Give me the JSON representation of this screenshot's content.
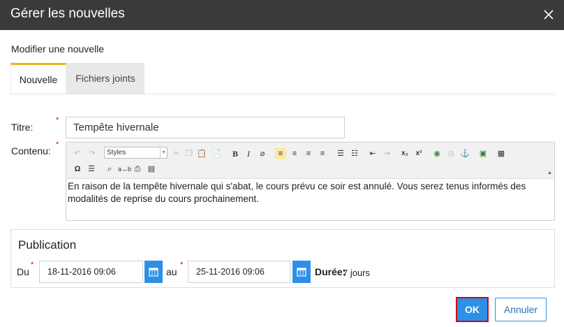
{
  "dialog": {
    "title": "Gérer les nouvelles",
    "subtitle": "Modifier une nouvelle",
    "tabs": [
      {
        "label": "Nouvelle",
        "active": true
      },
      {
        "label": "Fichiers joints",
        "active": false
      }
    ]
  },
  "form": {
    "title_label": "Titre:",
    "title_value": "Tempête hivernale",
    "content_label": "Contenu:",
    "required_mark": "*",
    "content_text": "En raison de la tempête hivernale qui s'abat, le cours prévu ce soir est annulé. Vous serez tenus informés des modalités de reprise du cours prochainement.",
    "toolbar": {
      "styles_label": "Styles"
    }
  },
  "publication": {
    "heading": "Publication",
    "from_label": "Du",
    "from_value": "18-11-2016 09:06",
    "to_label": "au",
    "to_value": "25-11-2016 09:06",
    "duration_label": "Durée:",
    "duration_value": "7 jours"
  },
  "actions": {
    "ok_label": "OK",
    "cancel_label": "Annuler"
  },
  "colors": {
    "titlebar": "#3a3a3a",
    "accent": "#2d8fe6",
    "tab_indicator": "#f2b01e",
    "required": "#d0021b"
  }
}
